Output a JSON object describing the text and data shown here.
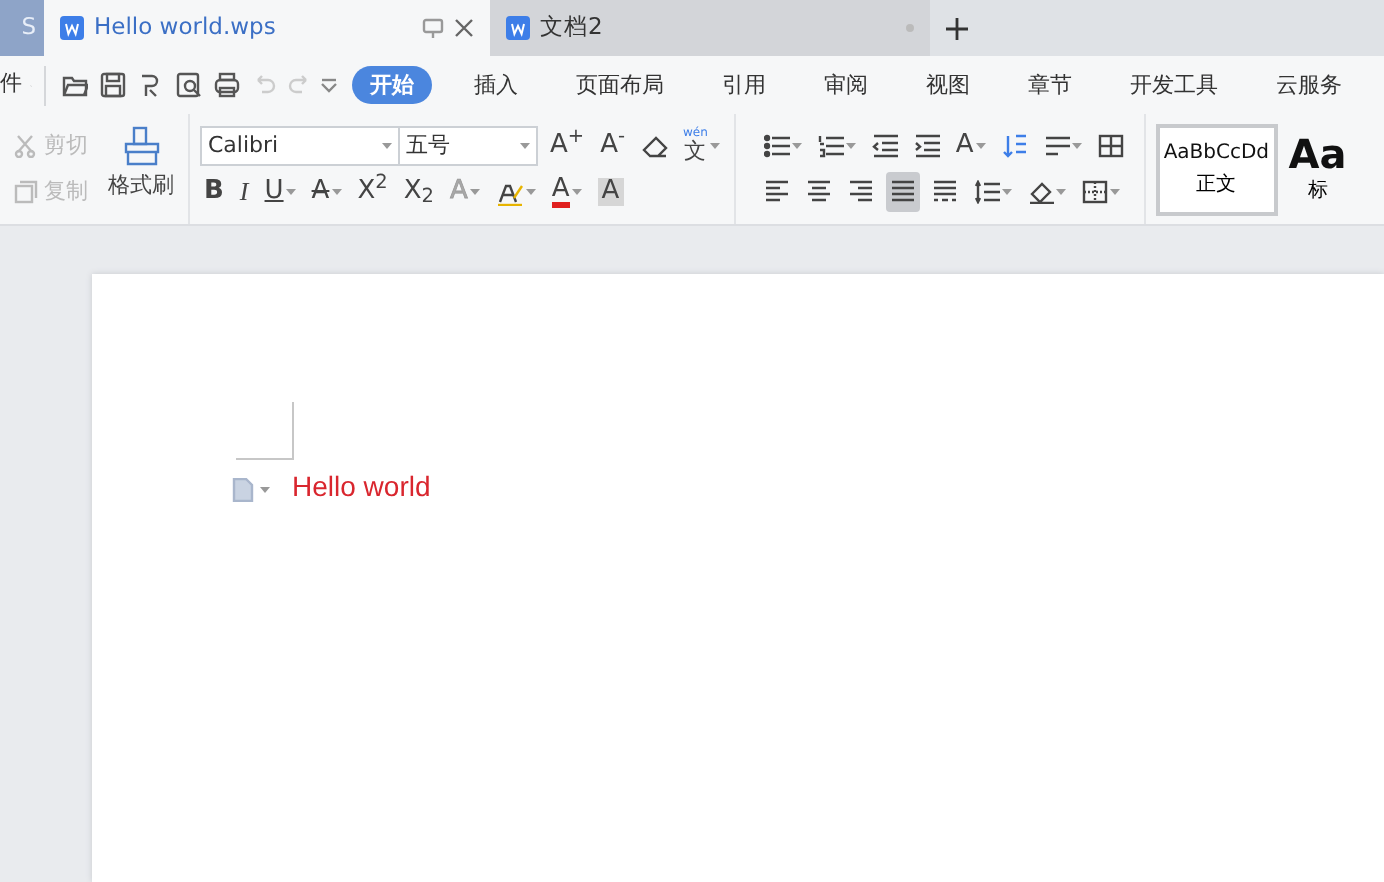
{
  "tabs": [
    {
      "label": "S",
      "kind": "app",
      "selected": false
    },
    {
      "label": "Hello world.wps",
      "kind": "doc",
      "selected": true
    },
    {
      "label": "文档2",
      "kind": "doc",
      "selected": false
    }
  ],
  "menu": {
    "file_label": "件",
    "tabs": [
      {
        "label": "开始",
        "selected": true
      },
      {
        "label": "插入",
        "selected": false
      },
      {
        "label": "页面布局",
        "selected": false
      },
      {
        "label": "引用",
        "selected": false
      },
      {
        "label": "审阅",
        "selected": false
      },
      {
        "label": "视图",
        "selected": false
      },
      {
        "label": "章节",
        "selected": false
      },
      {
        "label": "开发工具",
        "selected": false
      },
      {
        "label": "云服务",
        "selected": false
      }
    ]
  },
  "toolbar": {
    "clipboard": [
      {
        "label": "剪切",
        "kind": "cut",
        "disabled": true
      },
      {
        "label": "复制",
        "kind": "copy",
        "disabled": true
      }
    ],
    "format_painter": "格式刷",
    "font": {
      "value": "Calibri"
    },
    "size": {
      "value": "五号"
    },
    "font_row": [
      {
        "glyph": "A$^{+}$",
        "disabled": false
      },
      {
        "glyph": "A$^{-}$",
        "disabled": false
      }
    ],
    "phonetic": {
      "glyph": "文",
      "ruby": "wén"
    },
    "format_row": [
      {
        "glyph": "B",
        "kind": "bold",
        "disabled": false
      },
      {
        "glyph": "I",
        "kind": "italic",
        "disabled": false
      },
      {
        "glyph": "U",
        "kind": "underline",
        "disabled": false
      },
      {
        "glyph": "A",
        "kind": "strike",
        "disabled": false
      },
      {
        "glyph": "X$^{2}$",
        "kind": "plain",
        "disabled": false
      },
      {
        "glyph": "X$_{2}$",
        "kind": "plain",
        "disabled": false
      },
      {
        "glyph": "A",
        "kind": "effect",
        "disabled": true
      },
      {
        "glyph": "A",
        "kind": "color",
        "disabled": false
      },
      {
        "glyph": "A",
        "kind": "shade",
        "disabled": false
      }
    ],
    "direction": {
      "glyph": "A"
    },
    "alignment": [
      {
        "kind": "left",
        "selected": false
      },
      {
        "kind": "center",
        "selected": false
      },
      {
        "kind": "right",
        "selected": false
      },
      {
        "kind": "justify",
        "selected": true
      },
      {
        "kind": "distributed",
        "selected": false
      }
    ],
    "styles": [
      {
        "sample": "AaBbCcDd",
        "label": "正文",
        "selected": true,
        "kind": "body"
      },
      {
        "sample": "Aa",
        "label": "标",
        "selected": false,
        "kind": "heading"
      }
    ]
  },
  "document": {
    "text": "Hello world",
    "color": "#d9262e"
  }
}
